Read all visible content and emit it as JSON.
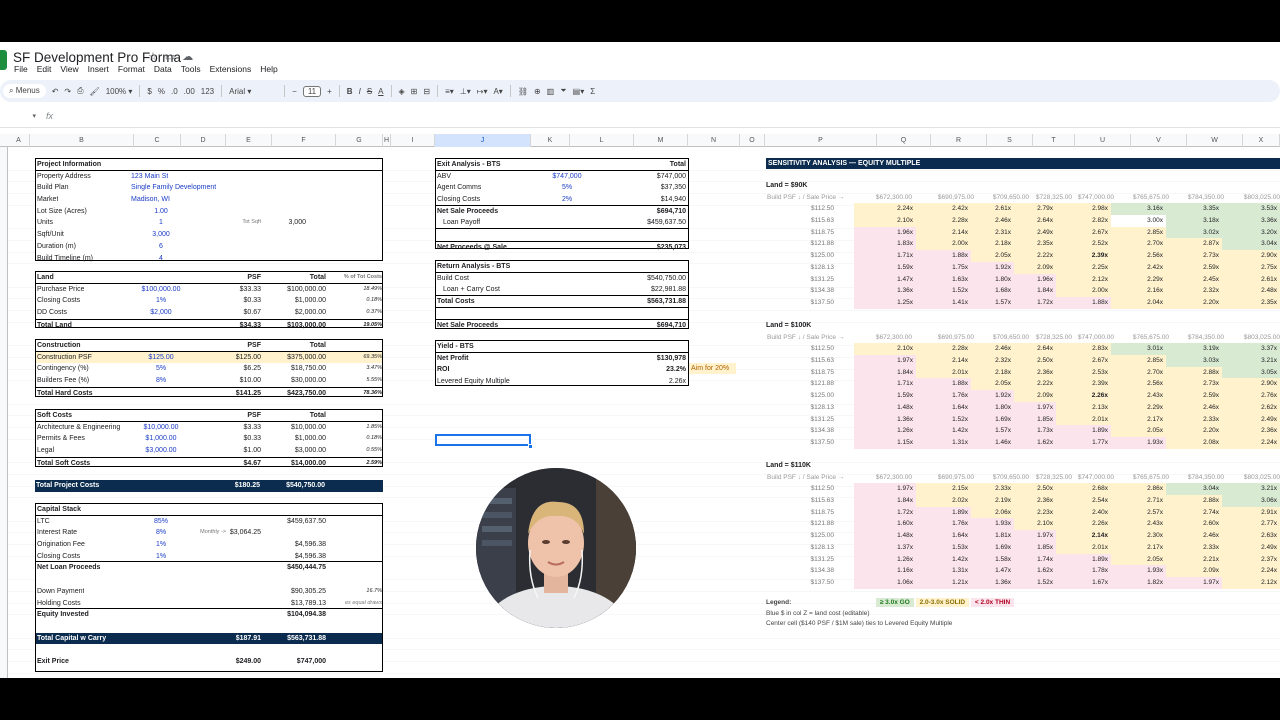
{
  "doc_title": "SF Development Pro Forma",
  "menu": [
    "File",
    "Edit",
    "View",
    "Insert",
    "Format",
    "Data",
    "Tools",
    "Extensions",
    "Help"
  ],
  "toolbar": {
    "menus": "Menus",
    "zoom": "100%",
    "currency": "$",
    "percent": "%",
    "dec_less": ".0",
    "dec_more": ".00",
    "format_123": "123",
    "font": "Arial",
    "font_size": "11"
  },
  "formula": {
    "fx": "fx",
    "namebox": "▾"
  },
  "columns": [
    "A",
    "B",
    "C",
    "D",
    "E",
    "F",
    "G",
    "H",
    "I",
    "J",
    "K",
    "L",
    "M",
    "N",
    "O",
    "P",
    "Q",
    "R",
    "S",
    "T",
    "U",
    "V",
    "W",
    "X"
  ],
  "project": [
    {
      "a": "Project Information",
      "b": true
    },
    {
      "a": "Property Address",
      "bv": "123 Main St"
    },
    {
      "a": "Build Plan",
      "bv": "Single Family Development"
    },
    {
      "a": "Market",
      "bv": "Madison, WI"
    },
    {
      "a": "Lot Size (Acres)",
      "cv": "1.00"
    },
    {
      "a": "Units",
      "cv": "1",
      "e": "Tot Sqft",
      "f": "3,000"
    },
    {
      "a": "Sqft/Unit",
      "cv": "3,000"
    },
    {
      "a": "Duration (m)",
      "cv": "6"
    },
    {
      "a": "Build Timeline (m)",
      "cv": "4"
    }
  ],
  "land": {
    "header": [
      "Land",
      "PSF",
      "Total",
      "% of Tot Costs"
    ],
    "rows": [
      [
        "Purchase Price",
        "$100,000.00",
        "$33.33",
        "$100,000.00",
        "18.49%"
      ],
      [
        "Closing Costs",
        "1%",
        "$0.33",
        "$1,000.00",
        "0.18%"
      ],
      [
        "DD Costs",
        "$2,000",
        "$0.67",
        "$2,000.00",
        "0.37%"
      ]
    ],
    "total": [
      "Total Land",
      "$34.33",
      "$103,000.00",
      "19.05%"
    ]
  },
  "construction": {
    "header": [
      "Construction",
      "PSF",
      "Total"
    ],
    "rows": [
      [
        "Construction PSF",
        "$125.00",
        "$125.00",
        "$375,000.00",
        "69.35%"
      ],
      [
        "Contingency (%)",
        "5%",
        "$6.25",
        "$18,750.00",
        "3.47%"
      ],
      [
        "Builders Fee (%)",
        "8%",
        "$10.00",
        "$30,000.00",
        "5.55%"
      ]
    ],
    "total": [
      "Total Hard Costs",
      "$141.25",
      "$423,750.00",
      "78.36%"
    ]
  },
  "soft": {
    "header": [
      "Soft Costs",
      "PSF",
      "Total"
    ],
    "rows": [
      [
        "Architecture & Engineering",
        "$10,000.00",
        "$3.33",
        "$10,000.00",
        "1.85%"
      ],
      [
        "Permits & Fees",
        "$1,000.00",
        "$0.33",
        "$1,000.00",
        "0.18%"
      ],
      [
        "Legal",
        "$3,000.00",
        "$1.00",
        "$3,000.00",
        "0.55%"
      ]
    ],
    "total": [
      "Total Soft Costs",
      "$4.67",
      "$14,000.00",
      "2.59%"
    ]
  },
  "total_project": [
    "Total Project Costs",
    "$180.25",
    "$540,750.00"
  ],
  "capital": {
    "header": "Capital Stack",
    "ltc": [
      "LTC",
      "85%",
      "$459,637.50"
    ],
    "rate": [
      "Interest Rate",
      "8%",
      "Monthly ->",
      "$3,064.25"
    ],
    "orig": [
      "Origination Fee",
      "1%",
      "$4,596.38"
    ],
    "closing": [
      "Closing Costs",
      "1%",
      "$4,596.38"
    ],
    "net": [
      "Net Loan Proceeds",
      "$450,444.75"
    ],
    "down": [
      "Down Payment",
      "$90,305.25",
      "16.7%"
    ],
    "holding": [
      "Holding Costs",
      "$13,789.13",
      "es equal draws"
    ],
    "equity": [
      "Equity Invested",
      "$104,094.38"
    ]
  },
  "total_capital": [
    "Total Capital w Carry",
    "$187.91",
    "$563,731.88"
  ],
  "exit_price": [
    "Exit Price",
    "$249.00",
    "$747,000"
  ],
  "exit": {
    "header": [
      "Exit Analysis - BTS",
      "Total"
    ],
    "rows": [
      [
        "ABV",
        "$747,000",
        "$747,000"
      ],
      [
        "Agent Comms",
        "5%",
        "$37,350"
      ],
      [
        "Closing Costs",
        "2%",
        "$14,940"
      ]
    ],
    "nsp": [
      "Net Sale Proceeds",
      "$694,710"
    ],
    "payoff": [
      "Loan Payoff",
      "$459,637.50"
    ],
    "proceeds": [
      "Net Proceeds @ Sale",
      "$235,073"
    ]
  },
  "return": {
    "header": "Return Analysis - BTS",
    "rows": [
      [
        "Build Cost",
        "$540,750.00"
      ],
      [
        "Loan + Carry Cost",
        "$22,981.88"
      ]
    ],
    "total": [
      "Total Costs",
      "$563,731.88"
    ],
    "nsp": [
      "Net Sale Proceeds",
      "$694,710"
    ]
  },
  "yield": {
    "header": "Yield - BTS",
    "profit": [
      "Net Profit",
      "$130,978"
    ],
    "roi": [
      "ROI",
      "23.2%"
    ],
    "aim": "Aim for 20%",
    "lem": [
      "Levered Equity Multiple",
      "2.26x"
    ]
  },
  "sensitivity": {
    "title": "SENSITIVITY ANALYSIS — EQUITY MULTIPLE",
    "axis_label": "Build PSF ↓ / Sale Price →",
    "sale_prices": [
      "$672,300.00",
      "$690,975.00",
      "$709,650.00",
      "$728,325.00",
      "$747,000.00",
      "$765,675.00",
      "$784,350.00",
      "$803,025.00"
    ],
    "build_psf": [
      "$112.50",
      "$115.63",
      "$118.75",
      "$121.88",
      "$125.00",
      "$128.13",
      "$131.25",
      "$134.38",
      "$137.50"
    ],
    "blocks": [
      {
        "title": "Land = $90K",
        "rows": [
          [
            "2.24x",
            "2.42x",
            "2.61x",
            "2.79x",
            "2.98x",
            "3.16x",
            "3.35x",
            "3.53x"
          ],
          [
            "2.10x",
            "2.28x",
            "2.46x",
            "2.64x",
            "2.82x",
            "3.00x",
            "3.18x",
            "3.36x"
          ],
          [
            "1.96x",
            "2.14x",
            "2.31x",
            "2.49x",
            "2.67x",
            "2.85x",
            "3.02x",
            "3.20x"
          ],
          [
            "1.83x",
            "2.00x",
            "2.18x",
            "2.35x",
            "2.52x",
            "2.70x",
            "2.87x",
            "3.04x"
          ],
          [
            "1.71x",
            "1.88x",
            "2.05x",
            "2.22x",
            "2.39x",
            "2.56x",
            "2.73x",
            "2.90x"
          ],
          [
            "1.59x",
            "1.75x",
            "1.92x",
            "2.09x",
            "2.25x",
            "2.42x",
            "2.59x",
            "2.75x"
          ],
          [
            "1.47x",
            "1.63x",
            "1.80x",
            "1.96x",
            "2.12x",
            "2.29x",
            "2.45x",
            "2.61x"
          ],
          [
            "1.36x",
            "1.52x",
            "1.68x",
            "1.84x",
            "2.00x",
            "2.16x",
            "2.32x",
            "2.48x"
          ],
          [
            "1.25x",
            "1.41x",
            "1.57x",
            "1.72x",
            "1.88x",
            "2.04x",
            "2.20x",
            "2.35x"
          ]
        ]
      },
      {
        "title": "Land = $100K",
        "rows": [
          [
            "2.10x",
            "2.28x",
            "2.46x",
            "2.64x",
            "2.83x",
            "3.01x",
            "3.19x",
            "3.37x"
          ],
          [
            "1.97x",
            "2.14x",
            "2.32x",
            "2.50x",
            "2.67x",
            "2.85x",
            "3.03x",
            "3.21x"
          ],
          [
            "1.84x",
            "2.01x",
            "2.18x",
            "2.36x",
            "2.53x",
            "2.70x",
            "2.88x",
            "3.05x"
          ],
          [
            "1.71x",
            "1.88x",
            "2.05x",
            "2.22x",
            "2.39x",
            "2.56x",
            "2.73x",
            "2.90x"
          ],
          [
            "1.59x",
            "1.76x",
            "1.92x",
            "2.09x",
            "2.26x",
            "2.43x",
            "2.59x",
            "2.76x"
          ],
          [
            "1.48x",
            "1.64x",
            "1.80x",
            "1.97x",
            "2.13x",
            "2.29x",
            "2.46x",
            "2.62x"
          ],
          [
            "1.36x",
            "1.52x",
            "1.69x",
            "1.85x",
            "2.01x",
            "2.17x",
            "2.33x",
            "2.49x"
          ],
          [
            "1.26x",
            "1.42x",
            "1.57x",
            "1.73x",
            "1.89x",
            "2.05x",
            "2.20x",
            "2.36x"
          ],
          [
            "1.15x",
            "1.31x",
            "1.46x",
            "1.62x",
            "1.77x",
            "1.93x",
            "2.08x",
            "2.24x"
          ]
        ]
      },
      {
        "title": "Land = $110K",
        "rows": [
          [
            "1.97x",
            "2.15x",
            "2.33x",
            "2.50x",
            "2.68x",
            "2.86x",
            "3.04x",
            "3.21x"
          ],
          [
            "1.84x",
            "2.02x",
            "2.19x",
            "2.36x",
            "2.54x",
            "2.71x",
            "2.88x",
            "3.06x"
          ],
          [
            "1.72x",
            "1.89x",
            "2.06x",
            "2.23x",
            "2.40x",
            "2.57x",
            "2.74x",
            "2.91x"
          ],
          [
            "1.60x",
            "1.76x",
            "1.93x",
            "2.10x",
            "2.26x",
            "2.43x",
            "2.60x",
            "2.77x"
          ],
          [
            "1.48x",
            "1.64x",
            "1.81x",
            "1.97x",
            "2.14x",
            "2.30x",
            "2.46x",
            "2.63x"
          ],
          [
            "1.37x",
            "1.53x",
            "1.69x",
            "1.85x",
            "2.01x",
            "2.17x",
            "2.33x",
            "2.49x"
          ],
          [
            "1.26x",
            "1.42x",
            "1.58x",
            "1.74x",
            "1.89x",
            "2.05x",
            "2.21x",
            "2.37x"
          ],
          [
            "1.16x",
            "1.31x",
            "1.47x",
            "1.62x",
            "1.78x",
            "1.93x",
            "2.09x",
            "2.24x"
          ],
          [
            "1.06x",
            "1.21x",
            "1.36x",
            "1.52x",
            "1.67x",
            "1.82x",
            "1.97x",
            "2.12x"
          ]
        ]
      }
    ],
    "legend": {
      "label": "Legend:",
      "go": "≥ 3.0x  GO",
      "solid": "2.0-3.0x  SOLID",
      "thin": "< 2.0x  THIN",
      "note1": "Blue $ in col Z = land cost (editable)",
      "note2": "Center cell ($140 PSF / $1M sale) ties to Levered Equity Multiple"
    },
    "colors": {
      "go": "#d9ead3",
      "solid": "#fff2cc",
      "thin": "#fce4ec",
      "header": "#0b2c4e"
    }
  }
}
